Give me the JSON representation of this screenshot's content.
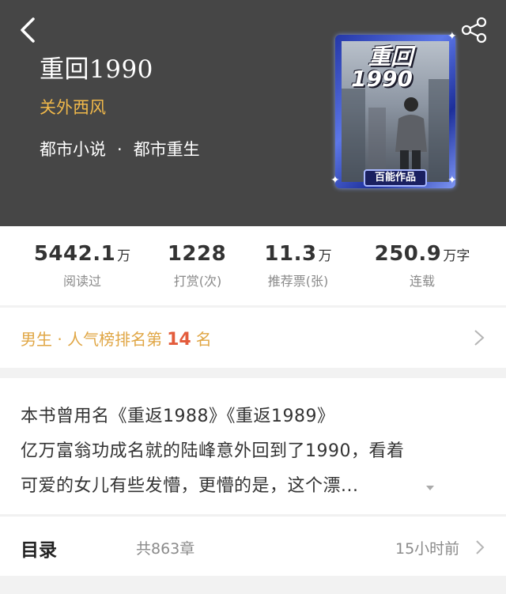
{
  "book": {
    "title": "重回1990",
    "author": "关外西风",
    "genre_primary": "都市小说",
    "genre_separator": "·",
    "genre_secondary": "都市重生"
  },
  "cover": {
    "title_line1": "重回",
    "title_line2": "1990",
    "badge": "百能作品"
  },
  "stats": [
    {
      "value": "5442.1",
      "unit": "万",
      "label": "阅读过"
    },
    {
      "value": "1228",
      "unit": "",
      "label": "打赏(次)"
    },
    {
      "value": "11.3",
      "unit": "万",
      "label": "推荐票(张)"
    },
    {
      "value": "250.9",
      "unit": "万字",
      "label": "连载"
    }
  ],
  "ranking": {
    "prefix": "男生 · 人气榜排名第",
    "rank": "14",
    "suffix": "名"
  },
  "description": {
    "line1": "本书曾用名《重返1988》《重返1989》",
    "line2": "亿万富翁功成名就的陆峰意外回到了1990，看着",
    "line3": "可爱的女儿有些发懵，更懵的是，这个漂..."
  },
  "toc": {
    "title": "目录",
    "chapter_count": "共863章",
    "updated": "15小时前"
  },
  "colors": {
    "header_bg": "#464646",
    "author": "#f0b84a",
    "rank_text": "#e0a644",
    "rank_number": "#e35c3c"
  },
  "icons": [
    "back-arrow-icon",
    "share-icon",
    "chevron-right-icon",
    "expand-arrow-icon"
  ]
}
